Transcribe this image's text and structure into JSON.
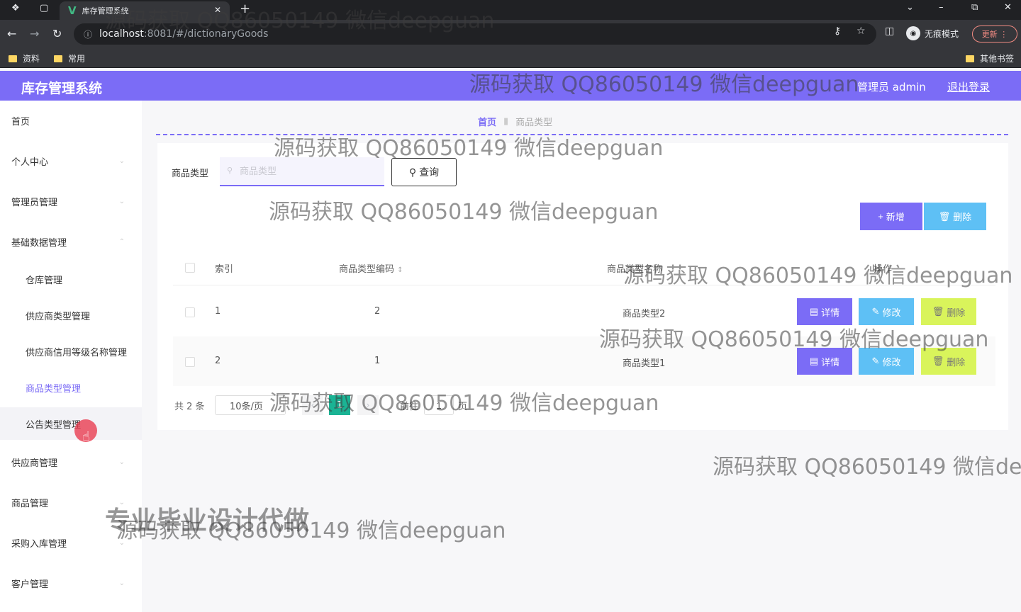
{
  "browser": {
    "tab_title": "库存管理系统",
    "url_host": "localhost",
    "url_path": ":8081/#/dictionaryGoods",
    "incognito_label": "无痕模式",
    "update_label": "更新",
    "bookmarks": [
      "资料",
      "常用"
    ],
    "other_bookmarks": "其他书签"
  },
  "header": {
    "app_title": "库存管理系统",
    "user_label": "管理员 admin",
    "logout_label": "退出登录",
    "accent_color": "#7b6cf6"
  },
  "sidebar": {
    "items": [
      {
        "label": "首页"
      },
      {
        "label": "个人中心"
      },
      {
        "label": "管理员管理"
      },
      {
        "label": "基础数据管理"
      }
    ],
    "sub_items": [
      {
        "label": "仓库管理"
      },
      {
        "label": "供应商类型管理"
      },
      {
        "label": "供应商信用等级名称管理"
      },
      {
        "label": "商品类型管理"
      },
      {
        "label": "公告类型管理"
      }
    ],
    "items_after": [
      {
        "label": "供应商管理"
      },
      {
        "label": "商品管理"
      },
      {
        "label": "采购入库管理"
      },
      {
        "label": "客户管理"
      }
    ]
  },
  "breadcrumb": {
    "home": "首页",
    "current": "商品类型"
  },
  "search": {
    "label": "商品类型",
    "placeholder": "商品类型",
    "query_label": "查询"
  },
  "toolbar": {
    "add_label": "新增",
    "delete_label": "删除"
  },
  "table": {
    "headers": [
      "索引",
      "商品类型编码",
      "商品类型名称",
      "操作"
    ],
    "rows": [
      {
        "index": "1",
        "code": "2",
        "name": "商品类型2"
      },
      {
        "index": "2",
        "code": "1",
        "name": "商品类型1"
      }
    ],
    "actions": {
      "detail": "详情",
      "edit": "修改",
      "delete": "删除"
    }
  },
  "pagination": {
    "total": "共 2 条",
    "page_size": "10条/页",
    "current_page": "1",
    "goto_prefix": "前往",
    "goto_value": "1",
    "goto_suffix": "页"
  },
  "watermarks": {
    "text": "源码获取 QQ86050149 微信deepguan",
    "bold_text": "专业毕业设计代做"
  }
}
